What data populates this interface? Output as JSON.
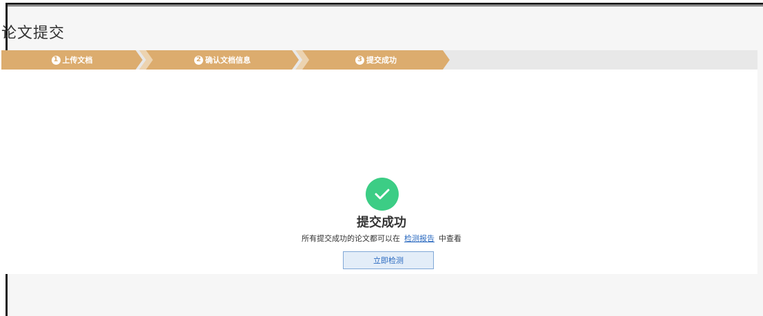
{
  "page": {
    "title": "论文提交"
  },
  "steps": [
    {
      "num": "1",
      "label": "上传文档"
    },
    {
      "num": "2",
      "label": "确认文档信息"
    },
    {
      "num": "3",
      "label": "提交成功"
    }
  ],
  "success": {
    "title": "提交成功",
    "desc_before": "所有提交成功的论文都可以在",
    "link_label": "检测报告",
    "desc_after": "中查看",
    "button_label": "立即检测"
  },
  "colors": {
    "step_active": "#dcac6e",
    "success_icon": "#3ccd85",
    "link": "#2b6ac0"
  },
  "icons": {
    "success": "check-icon"
  }
}
